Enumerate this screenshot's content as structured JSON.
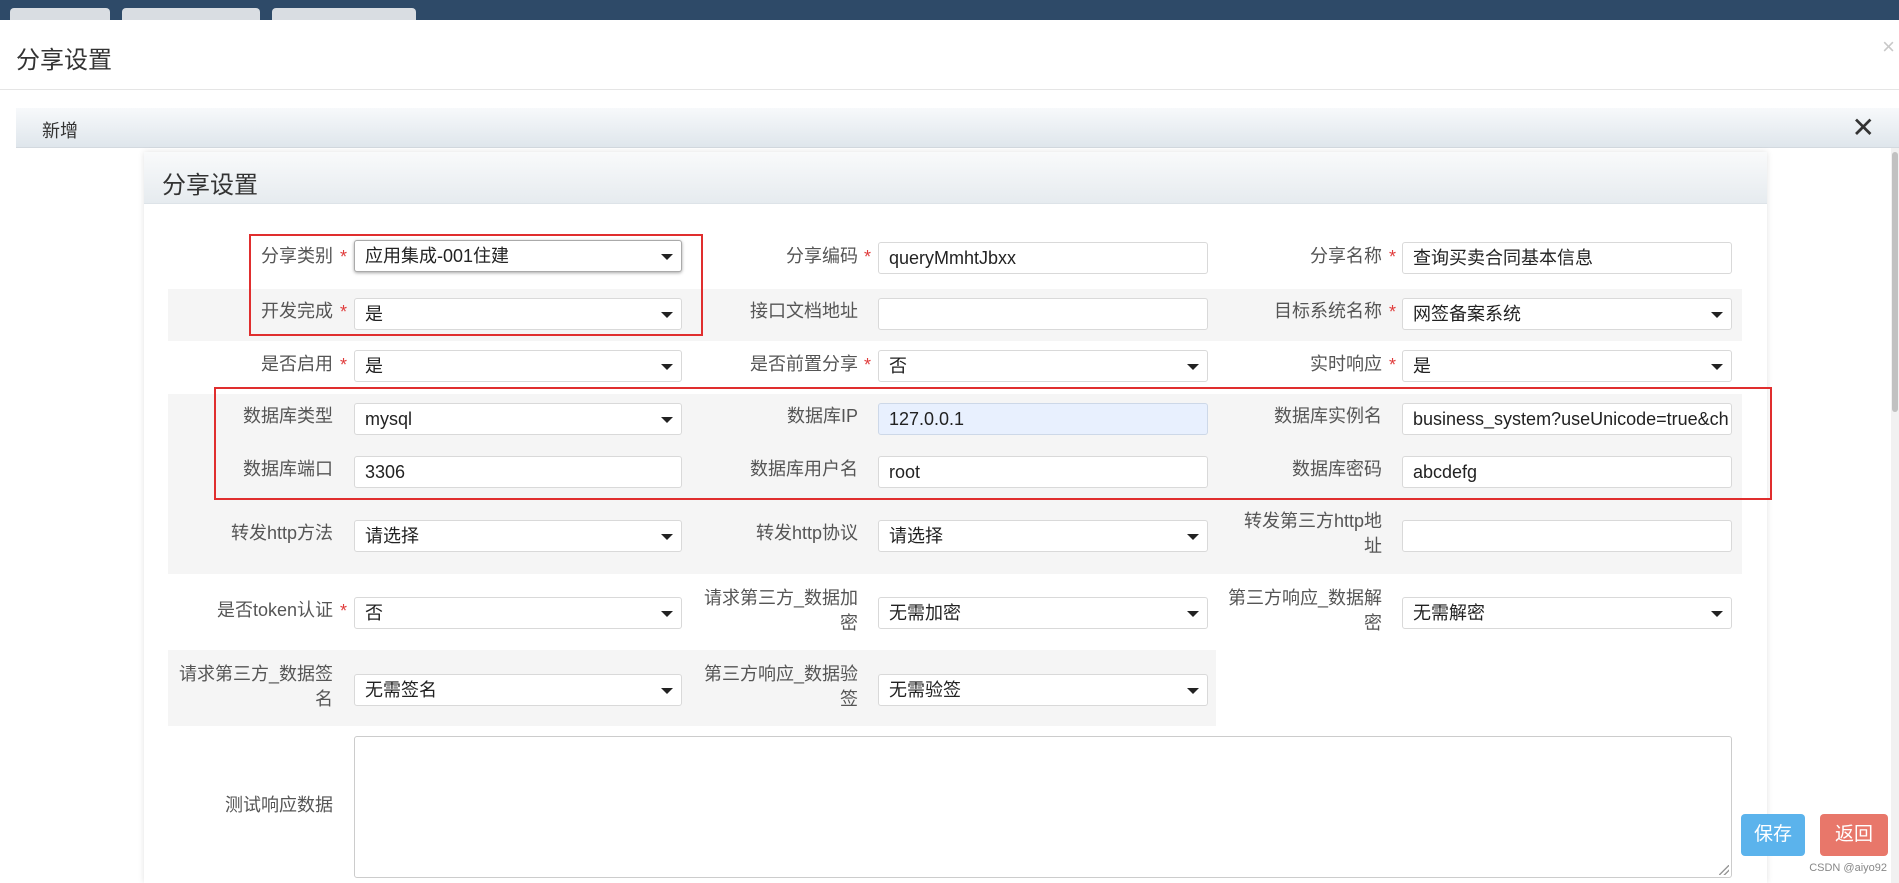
{
  "outer": {
    "title": "分享设置",
    "close": "×"
  },
  "dialog": {
    "title": "新增",
    "close": "✕"
  },
  "panel": {
    "title": "分享设置"
  },
  "required_mark": "*",
  "fields": {
    "share_type": {
      "label": "分享类别",
      "value": "应用集成-001住建"
    },
    "share_code": {
      "label": "分享编码",
      "value": "queryMmhtJbxx"
    },
    "share_name": {
      "label": "分享名称",
      "value": "查询买卖合同基本信息"
    },
    "dev_done": {
      "label": "开发完成",
      "value": "是"
    },
    "api_doc_url": {
      "label": "接口文档地址",
      "value": ""
    },
    "target_system": {
      "label": "目标系统名称",
      "value": "网签备案系统"
    },
    "enabled": {
      "label": "是否启用",
      "value": "是"
    },
    "pre_share": {
      "label": "是否前置分享",
      "value": "否"
    },
    "realtime": {
      "label": "实时响应",
      "value": "是"
    },
    "db_type": {
      "label": "数据库类型",
      "value": "mysql"
    },
    "db_ip": {
      "label": "数据库IP",
      "value": "127.0.0.1"
    },
    "db_instance": {
      "label": "数据库实例名",
      "value": "business_system?useUnicode=true&ch"
    },
    "db_port": {
      "label": "数据库端口",
      "value": "3306"
    },
    "db_user": {
      "label": "数据库用户名",
      "value": "root"
    },
    "db_password": {
      "label": "数据库密码",
      "value": "abcdefg"
    },
    "fwd_method": {
      "label": "转发http方法",
      "value": "请选择"
    },
    "fwd_protocol": {
      "label": "转发http协议",
      "value": "请选择"
    },
    "fwd_url": {
      "label_line1": "转发第三方http地",
      "label_line2": "址",
      "value": ""
    },
    "token_auth": {
      "label": "是否token认证",
      "value": "否"
    },
    "req_encrypt": {
      "label_line1": "请求第三方_数据加",
      "label_line2": "密",
      "value": "无需加密"
    },
    "resp_decrypt": {
      "label_line1": "第三方响应_数据解",
      "label_line2": "密",
      "value": "无需解密"
    },
    "req_sign": {
      "label_line1": "请求第三方_数据签",
      "label_line2": "名",
      "value": "无需签名"
    },
    "resp_verify": {
      "label_line1": "第三方响应_数据验",
      "label_line2": "签",
      "value": "无需验签"
    },
    "test_response": {
      "label": "测试响应数据",
      "value": ""
    }
  },
  "buttons": {
    "save": "保存",
    "back": "返回"
  },
  "watermark": "CSDN @aiyo92",
  "colors": {
    "highlight": "#e02e2e",
    "save": "#5bb3ec",
    "back": "#e8776a",
    "required": "#e03c3c"
  }
}
